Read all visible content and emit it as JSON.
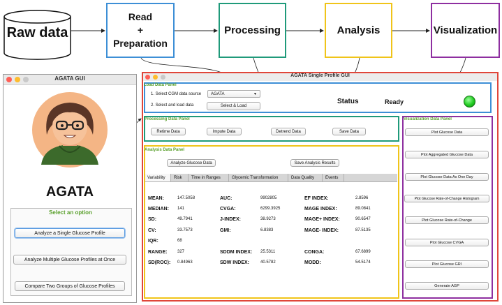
{
  "pipeline": {
    "raw": "Raw data",
    "read": [
      "Read",
      "+",
      "Preparation"
    ],
    "processing": "Processing",
    "analysis": "Analysis",
    "visualization": "Visualization"
  },
  "colors": {
    "read": "#3d8fd6",
    "processing": "#1f9a7a",
    "analysis": "#f0c419",
    "visualization": "#8e2fa0",
    "main_border": "#e0463a",
    "load_border": "#3d8fd6",
    "panel_title_green": "#5aa02c",
    "status_light": "#22cc22"
  },
  "agata_gui": {
    "window_title": "AGATA GUI",
    "app_name": "AGATA",
    "select_label": "Select an option",
    "options": [
      "Analyze a Single Glucose Profile",
      "Analyze Multiple Glucose Profiles at Once",
      "Compare Two Groups of Glucose Profiles"
    ]
  },
  "single_profile": {
    "window_title": "AGATA Single Profile GUI",
    "load_panel": {
      "title": "Load Data Panel",
      "step1": "1. Select CGM data source",
      "source_value": "AGATA",
      "step2": "2. Select and load data",
      "load_button": "Select & Load",
      "status_label": "Status",
      "status_value": "Ready"
    },
    "processing_panel": {
      "title": "Processing Data Panel",
      "buttons": [
        "Retime Data",
        "Impute Data",
        "Detrend Data",
        "Save Data"
      ]
    },
    "analysis_panel": {
      "title": "Analysis Data Panel",
      "analyze_button": "Analyze Glucose Data",
      "save_button": "Save Analysis Results",
      "tabs": [
        "Variability",
        "Risk",
        "Time in Ranges",
        "Glycemic Transformation",
        "Data Quality",
        "Events"
      ],
      "metrics": {
        "mean": {
          "label": "MEAN:",
          "value": "147.5058"
        },
        "median": {
          "label": "MEDIAN:",
          "value": "141"
        },
        "sd": {
          "label": "SD:",
          "value": "49.7941"
        },
        "cv": {
          "label": "CV:",
          "value": "33.7573"
        },
        "iqr": {
          "label": "IQR:",
          "value": "68"
        },
        "range": {
          "label": "RANGE:",
          "value": "327"
        },
        "sdroc": {
          "label": "SD(ROC):",
          "value": "0.84963"
        },
        "auc": {
          "label": "AUC:",
          "value": "9902805"
        },
        "cvga": {
          "label": "CVGA:",
          "value": "6299.3925"
        },
        "jindex": {
          "label": "J-INDEX:",
          "value": "38.9273"
        },
        "gmi": {
          "label": "GMI:",
          "value": "6.8383"
        },
        "sddm": {
          "label": "SDDM INDEX:",
          "value": "25.5311"
        },
        "sdw": {
          "label": "SDW INDEX:",
          "value": "40.5782"
        },
        "ef": {
          "label": "EF INDEX:",
          "value": "2.8596"
        },
        "mage": {
          "label": "MAGE INDEX:",
          "value": "89.0841"
        },
        "mageplus": {
          "label": "MAGE+ INDEX:",
          "value": "90.6547"
        },
        "mageminus": {
          "label": "MAGE- INDEX:",
          "value": "87.5135"
        },
        "conga": {
          "label": "CONGA:",
          "value": "67.6899"
        },
        "modd": {
          "label": "MODD:",
          "value": "54.5174"
        }
      }
    },
    "visualization_panel": {
      "title": "Visualization Data Panel",
      "buttons": [
        "Plot Glucose Data",
        "Plot Aggregated Glucose Data",
        "Plot Glucose Data As One Day",
        "Plot Glucose Rate-of-Change Histogram",
        "Plot Glucose Rate-of-Change",
        "Plot Glucose CVGA",
        "Plot Glucose GRI",
        "Generate AGP"
      ]
    }
  }
}
